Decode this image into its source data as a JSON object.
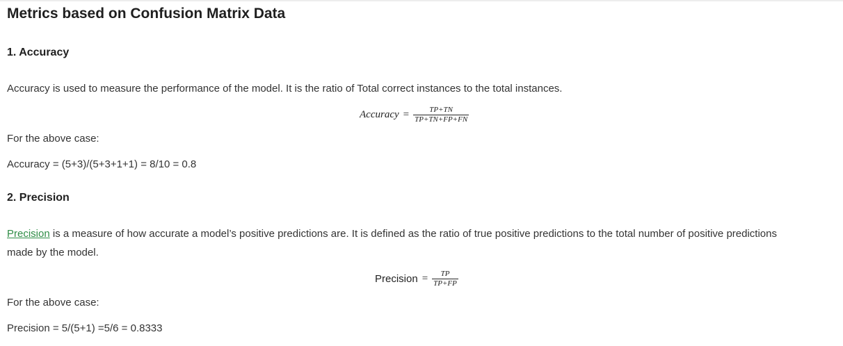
{
  "title": "Metrics based on Confusion Matrix Data",
  "accuracy": {
    "heading": "1. Accuracy",
    "description": "Accuracy is used to measure the performance of the model. It is the ratio of Total correct instances to the total instances.",
    "formula": {
      "lhs": "Accuracy",
      "equals": "=",
      "numerator": "TP+TN",
      "denominator": "TP+TN+FP+FN"
    },
    "case_label": "For the above case:",
    "calculation": "Accuracy = (5+3)/(5+3+1+1) = 8/10 = 0.8"
  },
  "precision": {
    "heading": "2. Precision",
    "link_text": "Precision",
    "description_rest": " is a measure of how accurate a model’s positive predictions are. It is defined as the ratio of true positive predictions to the total number of positive predictions made by the model.",
    "formula": {
      "lhs": "Precision",
      "equals": "=",
      "numerator": "TP",
      "denominator": "TP+FP"
    },
    "case_label": "For the above case:",
    "calculation": "Precision = 5/(5+1) =5/6 = 0.8333"
  },
  "colors": {
    "link": "#2f8d46",
    "text": "#333333",
    "heading": "#1f1f1f"
  }
}
